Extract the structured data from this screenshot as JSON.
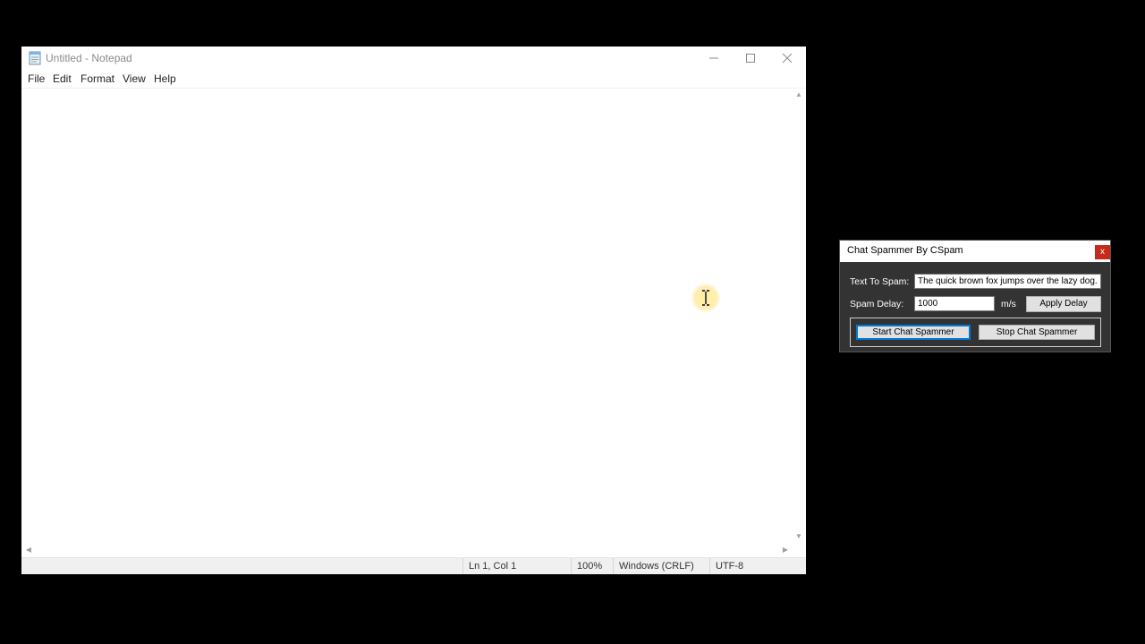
{
  "notepad": {
    "title": "Untitled - Notepad",
    "menu": [
      "File",
      "Edit",
      "Format",
      "View",
      "Help"
    ],
    "content": "",
    "status": {
      "position": "Ln 1, Col 1",
      "zoom": "100%",
      "line_ending": "Windows (CRLF)",
      "encoding": "UTF-8"
    },
    "icons": {
      "app": "notepad-icon",
      "minimize": "minimize-icon",
      "maximize": "maximize-icon",
      "close": "close-icon"
    }
  },
  "spammer": {
    "title": "Chat Spammer By CSpam",
    "close_label": "x",
    "text_label": "Text To Spam:",
    "text_value": "The quick brown fox jumps over the lazy dog.",
    "delay_label": "Spam Delay:",
    "delay_value": "1000",
    "delay_unit": "m/s",
    "apply_label": "Apply Delay",
    "start_label": "Start Chat Spammer",
    "stop_label": "Stop Chat Spammer"
  },
  "colors": {
    "desktop": "#000000",
    "dialog_bg": "#333333",
    "close_red": "#c42b1c",
    "cursor_highlight": "#ffe27a"
  }
}
